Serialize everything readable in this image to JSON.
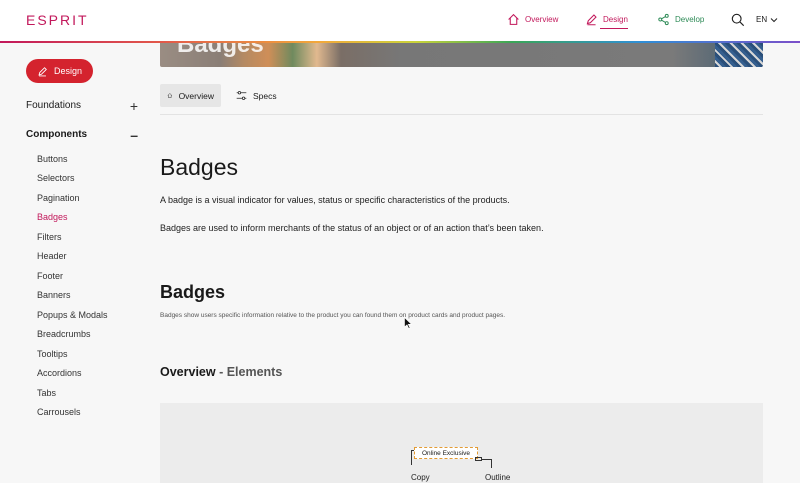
{
  "header": {
    "logo": "ESPRIT",
    "nav": {
      "overview": "Overview",
      "design": "Design",
      "develop": "Develop"
    },
    "lang": "EN"
  },
  "sidebar": {
    "design_button": "Design",
    "foundations": "Foundations",
    "components": "Components",
    "items": [
      "Buttons",
      "Selectors",
      "Pagination",
      "Badges",
      "Filters",
      "Header",
      "Footer",
      "Banners",
      "Popups & Modals",
      "Breadcrumbs",
      "Tooltips",
      "Accordions",
      "Tabs",
      "Carrousels"
    ],
    "active_item": "Badges"
  },
  "main": {
    "tabs": {
      "overview": "Overview",
      "specs": "Specs"
    },
    "title": "Badges",
    "intro1": "A badge is a visual indicator for values, status or specific characteristics of the products.",
    "intro2": "Badges are used to inform merchants of the status of an object or of an action that’s been taken.",
    "section_title": "Badges",
    "section_desc": "Badges show users specific information relative to the product you can found them on product cards and product pages.",
    "overview_title": "Overview",
    "overview_sep": " - ",
    "overview_sub": "Elements",
    "badge_text": "Online Exclusive",
    "label_copy": "Copy",
    "label_outline": "Outline"
  },
  "colors": {
    "brand": "#c2185b",
    "develop": "#2e8b57",
    "button": "#d4232e"
  }
}
